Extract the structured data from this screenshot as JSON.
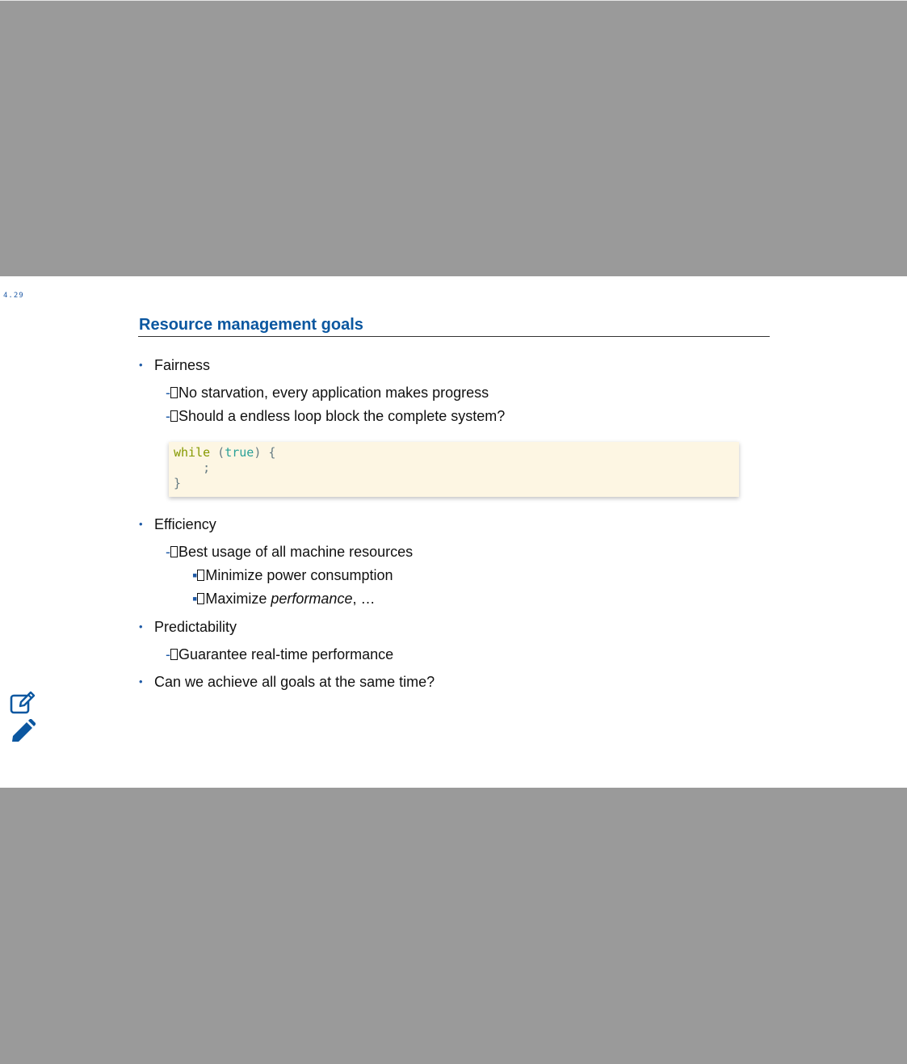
{
  "slide": {
    "number": "4.29",
    "title": "Resource management goals"
  },
  "bullets": [
    {
      "label": "Fairness",
      "subs": [
        "No starvation, every application makes progress",
        "Should a endless loop block the complete system?"
      ]
    },
    {
      "label": "Efficiency",
      "subs": [
        "Best usage of all machine resources"
      ],
      "subsubs": [
        "Minimize power consumption",
        {
          "prefix": "Maximize ",
          "italic": "performance",
          "suffix": ", …"
        }
      ]
    },
    {
      "label": "Predictability",
      "subs": [
        "Guarantee real-time performance"
      ]
    },
    {
      "label": "Can we achieve all goals at the same time?"
    }
  ],
  "code": {
    "line1_kw": "while",
    "line1_open": " (",
    "line1_lit": "true",
    "line1_close": ") {",
    "line2": "    ;",
    "line3": "}"
  },
  "markers": {
    "bullet": "•",
    "dash": "-",
    "square": "▪"
  },
  "icons": {
    "edit_note": "edit-note-icon",
    "pencil": "pencil-icon"
  },
  "colors": {
    "accent": "#0b57a0",
    "code_bg": "#fdf6e3",
    "background": "#9a9a9a"
  }
}
